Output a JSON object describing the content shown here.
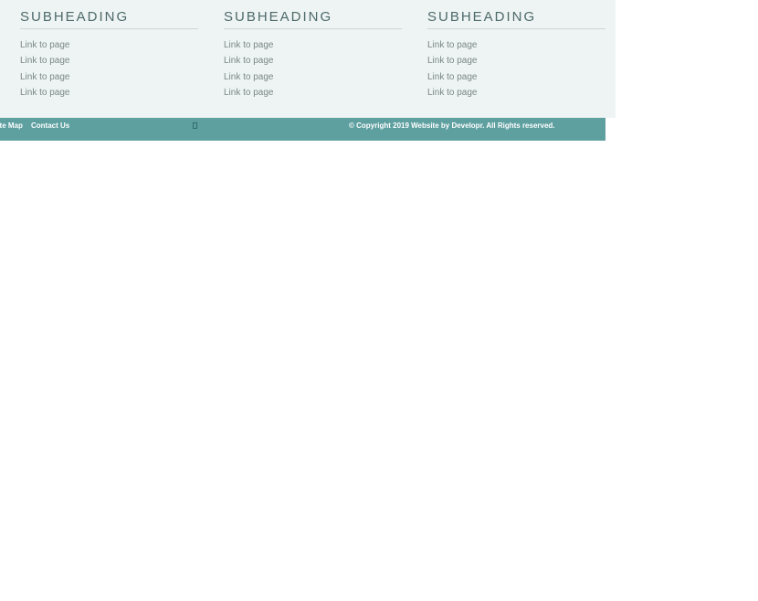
{
  "footer": {
    "columns": [
      {
        "heading": "SUBHEADING",
        "links": [
          "Link to page",
          "Link to page",
          "Link to page",
          "Link to page"
        ]
      },
      {
        "heading": "SUBHEADING",
        "links": [
          "Link to page",
          "Link to page",
          "Link to page",
          "Link to page"
        ]
      },
      {
        "heading": "SUBHEADING",
        "links": [
          "Link to page",
          "Link to page",
          "Link to page",
          "Link to page"
        ]
      }
    ]
  },
  "bottom_bar": {
    "sitemap_label": "Site Map",
    "contact_label": "Contact Us",
    "copyright": "© Copyright 2019 Website by Developr. All Rights reserved.",
    "icon": "missing-glyph-icon"
  },
  "colors": {
    "footer_background": "#eef3f3",
    "bar_background": "#5e9fa0",
    "heading": "#4d6a6a",
    "link": "#7a8787"
  }
}
